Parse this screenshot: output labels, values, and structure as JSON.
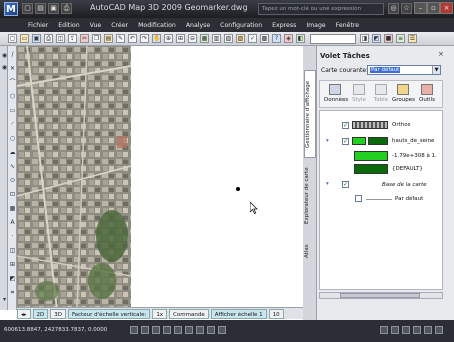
{
  "window": {
    "title": "AutoCAD Map 3D 2009  Geomarker.dwg",
    "search_placeholder": "Tapez un mot-clé ou une expression"
  },
  "menu": [
    "Fichier",
    "Edition",
    "Vue",
    "Créer",
    "Modification",
    "Analyse",
    "Configuration",
    "Express",
    "Image",
    "Fenêtre"
  ],
  "panel": {
    "title": "Volet Tâches",
    "close": "×",
    "carte_label": "Carte courante:",
    "carte_value": "Par défaut",
    "tabs": [
      "Gestionnaire d'affichage",
      "Explorateur de carte",
      "Atlas"
    ],
    "buttons": [
      {
        "label": "Données",
        "enabled": true
      },
      {
        "label": "Style",
        "enabled": false
      },
      {
        "label": "Table",
        "enabled": false
      },
      {
        "label": "Groupes",
        "enabled": true
      },
      {
        "label": "Outils",
        "enabled": true
      }
    ],
    "layers": {
      "orthos": "Orthos",
      "hauts": "hauts_de_seine",
      "range": "-1.79e+308 à 1.",
      "default": "{DEFAULT}",
      "base": "Base de la carte",
      "par_defaut": "Par défaut"
    },
    "colors": {
      "green": "#22d022",
      "dark_green": "#0a6a0a"
    }
  },
  "tabs": {
    "t2d": "2D",
    "t3d": "3D",
    "facteur": "Facteur d'échelle verticale:",
    "factor_value": "1x",
    "commande": "Commande",
    "afficher": "Afficher échelle 1",
    "ten": "10"
  },
  "status": {
    "coords": "600613.8847, 2427833.7837, 0.0000"
  }
}
